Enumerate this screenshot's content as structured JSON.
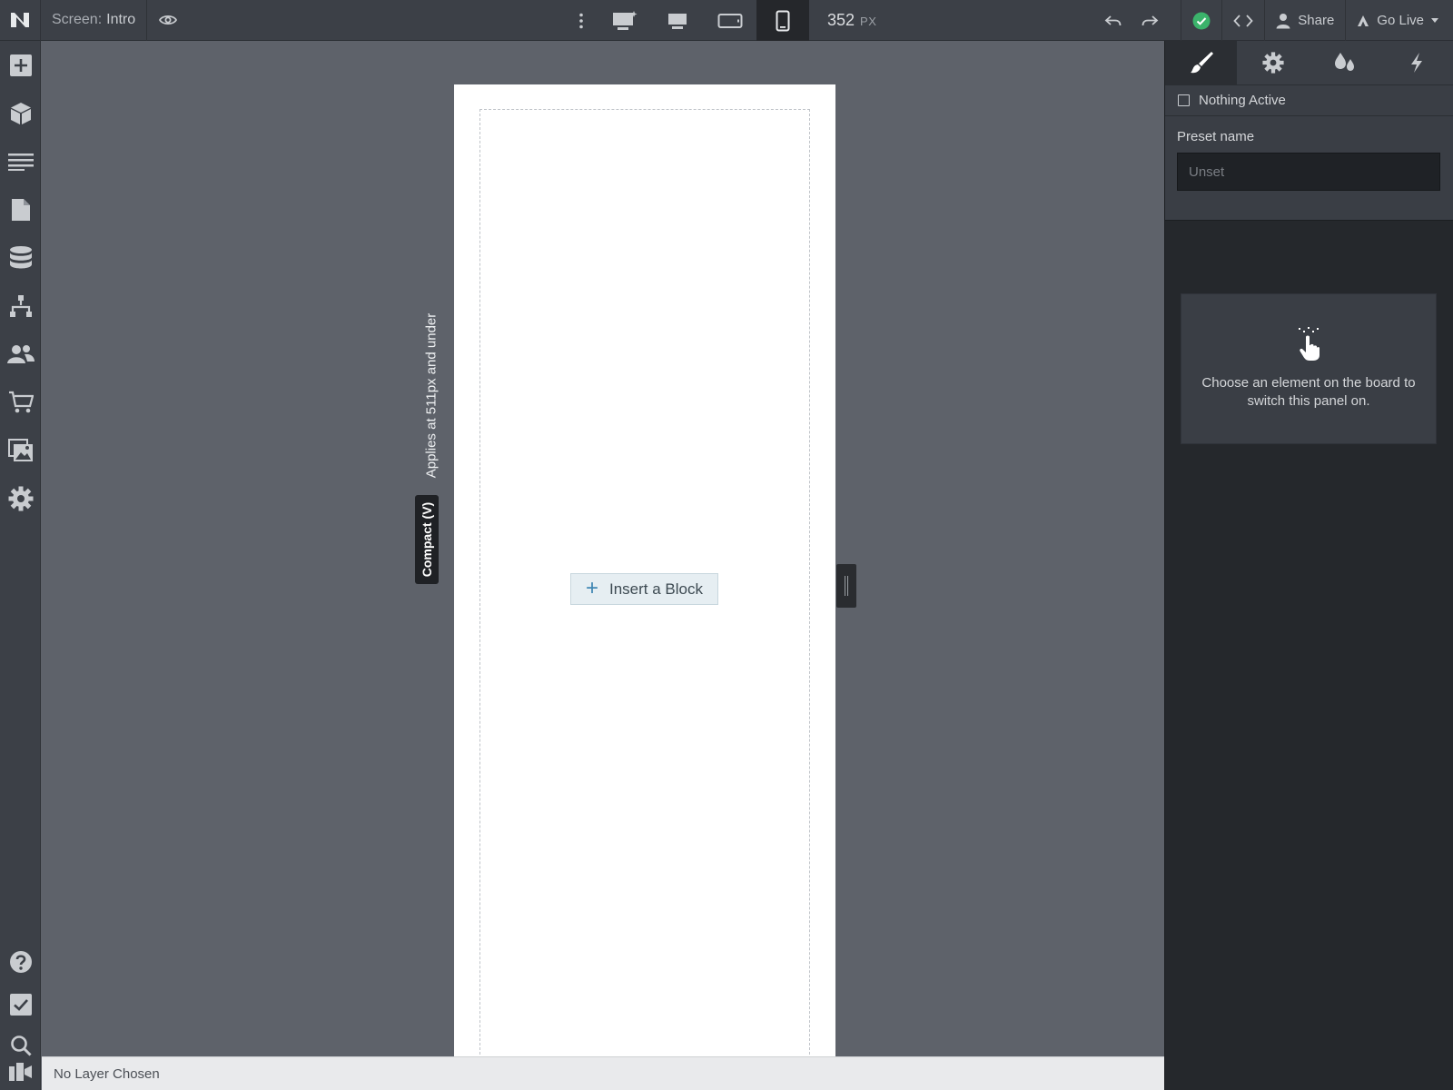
{
  "topbar": {
    "logo": "N",
    "screen_label": "Screen:",
    "screen_name": "Intro",
    "width_value": "352",
    "width_unit": "PX",
    "share_label": "Share",
    "golive_label": "Go Live",
    "icons": {
      "preview": "eye-icon",
      "more": "kebab-icon",
      "devices": [
        "desktop-large-icon",
        "desktop-icon",
        "tablet-icon",
        "phone-icon"
      ],
      "active_device": "phone-icon",
      "undo": "undo-icon",
      "redo": "redo-icon",
      "status": "check-circle-icon",
      "code": "code-icon",
      "user": "user-icon",
      "golive": "golive-icon",
      "caret": "caret-down-icon"
    },
    "colors": {
      "status_ok": "#3bb36b"
    }
  },
  "sidebar": {
    "items": [
      "add-icon",
      "cube-icon",
      "menu-lines-icon",
      "page-icon",
      "database-icon",
      "flow-icon",
      "users-icon",
      "cart-icon",
      "media-icon",
      "settings-icon"
    ],
    "bottom_items": [
      "help-icon",
      "checklist-icon",
      "search-icon",
      "video-icon"
    ]
  },
  "canvas": {
    "breakpoint_applies": "Applies at 511px and under",
    "breakpoint_name": "Compact (V)",
    "insert_label": "Insert a Block",
    "colors": {
      "frame": "#ffffff",
      "insert_plus": "#3f86b3"
    }
  },
  "statusbar": {
    "text": "No Layer Chosen"
  },
  "panel": {
    "tabs": [
      "brush-icon",
      "gear-icon",
      "drops-icon",
      "bolt-icon"
    ],
    "active_tab": "brush-icon",
    "nothing_active": "Nothing Active",
    "preset_label": "Preset name",
    "preset_placeholder": "Unset",
    "empty_message": "Choose an element on the board to switch this panel on.",
    "empty_icon": "tap-hand-icon"
  }
}
